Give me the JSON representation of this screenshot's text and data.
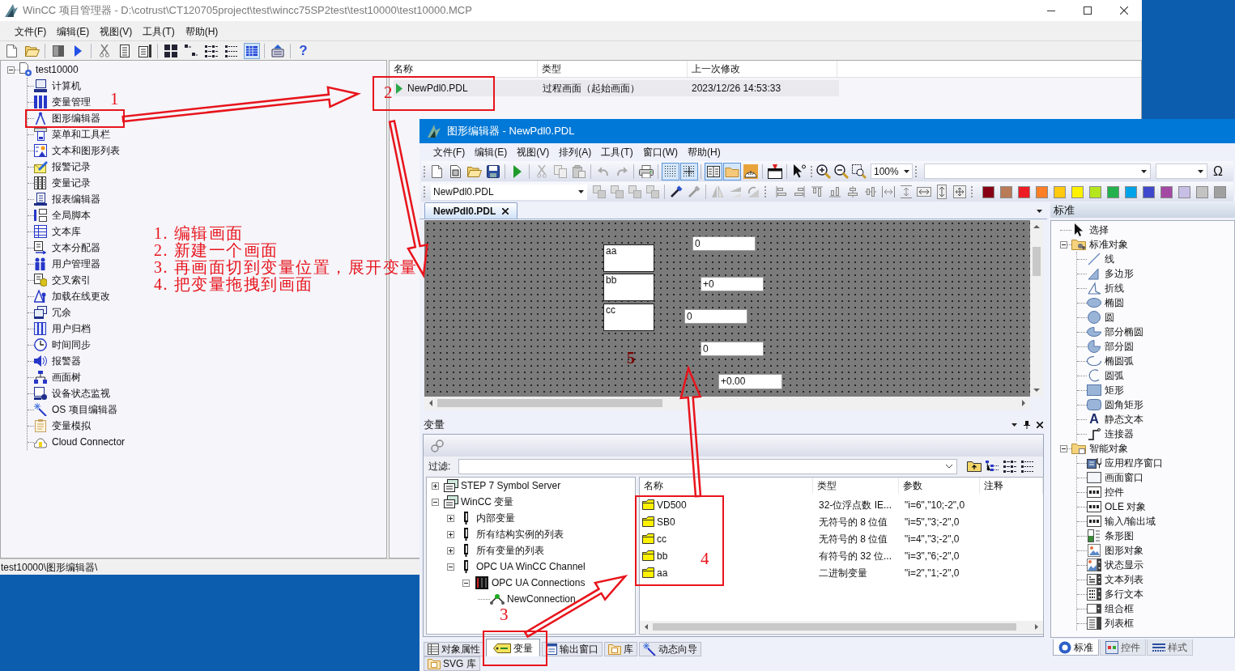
{
  "project_manager": {
    "title": "WinCC 项目管理器 - D:\\cotrust\\CT120705project\\test\\wincc75SP2test\\test10000\\test10000.MCP",
    "menu": [
      "文件(F)",
      "编辑(E)",
      "视图(V)",
      "工具(T)",
      "帮助(H)"
    ],
    "toolbar": {
      "help_glyph": "?"
    },
    "tree": {
      "label": "test10000",
      "expanded": true,
      "children": [
        {
          "label": "计算机"
        },
        {
          "label": "变量管理"
        },
        {
          "label": "图形编辑器"
        },
        {
          "label": "菜单和工具栏"
        },
        {
          "label": "文本和图形列表"
        },
        {
          "label": "报警记录"
        },
        {
          "label": "变量记录"
        },
        {
          "label": "报表编辑器"
        },
        {
          "label": "全局脚本"
        },
        {
          "label": "文本库"
        },
        {
          "label": "文本分配器"
        },
        {
          "label": "用户管理器"
        },
        {
          "label": "交叉索引"
        },
        {
          "label": "加载在线更改"
        },
        {
          "label": "冗余"
        },
        {
          "label": "用户归档"
        },
        {
          "label": "时间同步"
        },
        {
          "label": "报警器"
        },
        {
          "label": "画面树"
        },
        {
          "label": "设备状态监视"
        },
        {
          "label": "OS 项目编辑器"
        },
        {
          "label": "变量模拟"
        },
        {
          "label": "Cloud Connector"
        }
      ]
    },
    "list": {
      "columns": [
        "名称",
        "类型",
        "上一次修改"
      ],
      "rows": [
        [
          "NewPdl0.PDL",
          "过程画面（起始画面）",
          "2023/12/26 14:53:33"
        ]
      ]
    },
    "status_bar": "test10000\\图形编辑器\\"
  },
  "graphics_designer": {
    "title": "图形编辑器 - NewPdl0.PDL",
    "menu": [
      "文件(F)",
      "编辑(E)",
      "视图(V)",
      "排列(A)",
      "工具(T)",
      "窗口(W)",
      "帮助(H)"
    ],
    "toolbar": {
      "zoom": "100%",
      "symbol_glyph": "Ω"
    },
    "picture_select": "NewPdl0.PDL",
    "swatches": [
      {
        "color": "#880015"
      },
      {
        "color": "#b97a57"
      },
      {
        "color": "#ed1c24"
      },
      {
        "color": "#ff7f27"
      },
      {
        "color": "#ffc90e"
      },
      {
        "color": "#fff200"
      },
      {
        "color": "#b5e61d"
      },
      {
        "color": "#22b14c"
      },
      {
        "color": "#00a2e8"
      },
      {
        "color": "#3f48cc"
      },
      {
        "color": "#a349a4"
      },
      {
        "color": "#c8bfe7"
      },
      {
        "color": "#c3c3c3"
      },
      {
        "color": "#a0a0a0"
      }
    ],
    "tabs": [
      {
        "label": "NewPdl0.PDL",
        "selected": true
      }
    ],
    "canvas": {
      "objects": [
        {
          "kind": "io_field",
          "text": "0"
        },
        {
          "kind": "static_text",
          "text": "aa"
        },
        {
          "kind": "static_text",
          "text": "bb"
        },
        {
          "kind": "io_field",
          "text": "+0"
        },
        {
          "kind": "static_text",
          "text": "cc"
        },
        {
          "kind": "io_field",
          "text": "0"
        },
        {
          "kind": "io_field",
          "text": "0"
        },
        {
          "kind": "io_field",
          "text": "+0.00"
        }
      ]
    },
    "tags_panel": {
      "title": "变量",
      "filter_label": "过滤:",
      "tree": [
        {
          "label": "STEP 7 Symbol Server",
          "expanded": false
        },
        {
          "label": "WinCC 变量",
          "expanded": true,
          "children": [
            {
              "label": "内部变量",
              "expanded": false
            },
            {
              "label": "所有结构实例的列表",
              "expanded": false
            },
            {
              "label": "所有变量的列表",
              "expanded": false
            },
            {
              "label": "OPC UA WinCC Channel",
              "expanded": true,
              "children": [
                {
                  "label": "OPC UA Connections",
                  "expanded": true,
                  "children": [
                    {
                      "label": "NewConnection"
                    }
                  ]
                }
              ]
            }
          ]
        }
      ],
      "table": {
        "columns": [
          "名称",
          "类型",
          "参数",
          "注释"
        ],
        "rows": [
          [
            "VD500",
            "32-位浮点数 IE...",
            "\"i=6\",\"10;-2\",0"
          ],
          [
            "SB0",
            "无符号的 8 位值",
            "\"i=5\",\"3;-2\",0"
          ],
          [
            "cc",
            "无符号的 8 位值",
            "\"i=4\",\"3;-2\",0"
          ],
          [
            "bb",
            "有符号的 32 位...",
            "\"i=3\",\"6;-2\",0"
          ],
          [
            "aa",
            "二进制变量",
            "\"i=2\",\"1;-2\",0"
          ]
        ]
      }
    },
    "dock_tabs": [
      [
        {
          "label": "对象属性",
          "selected": false
        },
        {
          "label": "变量",
          "selected": true
        },
        {
          "label": "输出窗口",
          "selected": false
        },
        {
          "label": "库",
          "selected": false
        },
        {
          "label": "动态向导",
          "selected": false
        }
      ],
      [
        {
          "label": "SVG 库",
          "selected": false
        }
      ]
    ],
    "palette": {
      "title": "标准",
      "tree": [
        {
          "label": "选择"
        },
        {
          "label": "标准对象",
          "expanded": true,
          "children": [
            {
              "label": "线"
            },
            {
              "label": "多边形"
            },
            {
              "label": "折线"
            },
            {
              "label": "椭圆"
            },
            {
              "label": "圆"
            },
            {
              "label": "部分椭圆"
            },
            {
              "label": "部分圆"
            },
            {
              "label": "椭圆弧"
            },
            {
              "label": "圆弧"
            },
            {
              "label": "矩形"
            },
            {
              "label": "圆角矩形"
            },
            {
              "label": "静态文本",
              "glyph": "A"
            },
            {
              "label": "连接器"
            }
          ]
        },
        {
          "label": "智能对象",
          "expanded": true,
          "children": [
            {
              "label": "应用程序窗口"
            },
            {
              "label": "画面窗口"
            },
            {
              "label": "控件"
            },
            {
              "label": "OLE 对象"
            },
            {
              "label": "输入/输出域"
            },
            {
              "label": "条形图"
            },
            {
              "label": "图形对象"
            },
            {
              "label": "状态显示"
            },
            {
              "label": "文本列表"
            },
            {
              "label": "多行文本"
            },
            {
              "label": "组合框"
            },
            {
              "label": "列表框"
            }
          ]
        }
      ],
      "tabs": [
        {
          "label": "标准",
          "selected": true
        },
        {
          "label": "控件",
          "selected": false
        },
        {
          "label": "样式",
          "selected": false
        }
      ]
    }
  },
  "annotations": {
    "steps": [
      "1. 编辑画面",
      "2. 新建一个画面",
      "3. 再画面切到变量位置，展开变量",
      "4. 把变量拖拽到画面"
    ],
    "numbers": [
      "1",
      "2",
      "3",
      "4",
      "5"
    ]
  }
}
